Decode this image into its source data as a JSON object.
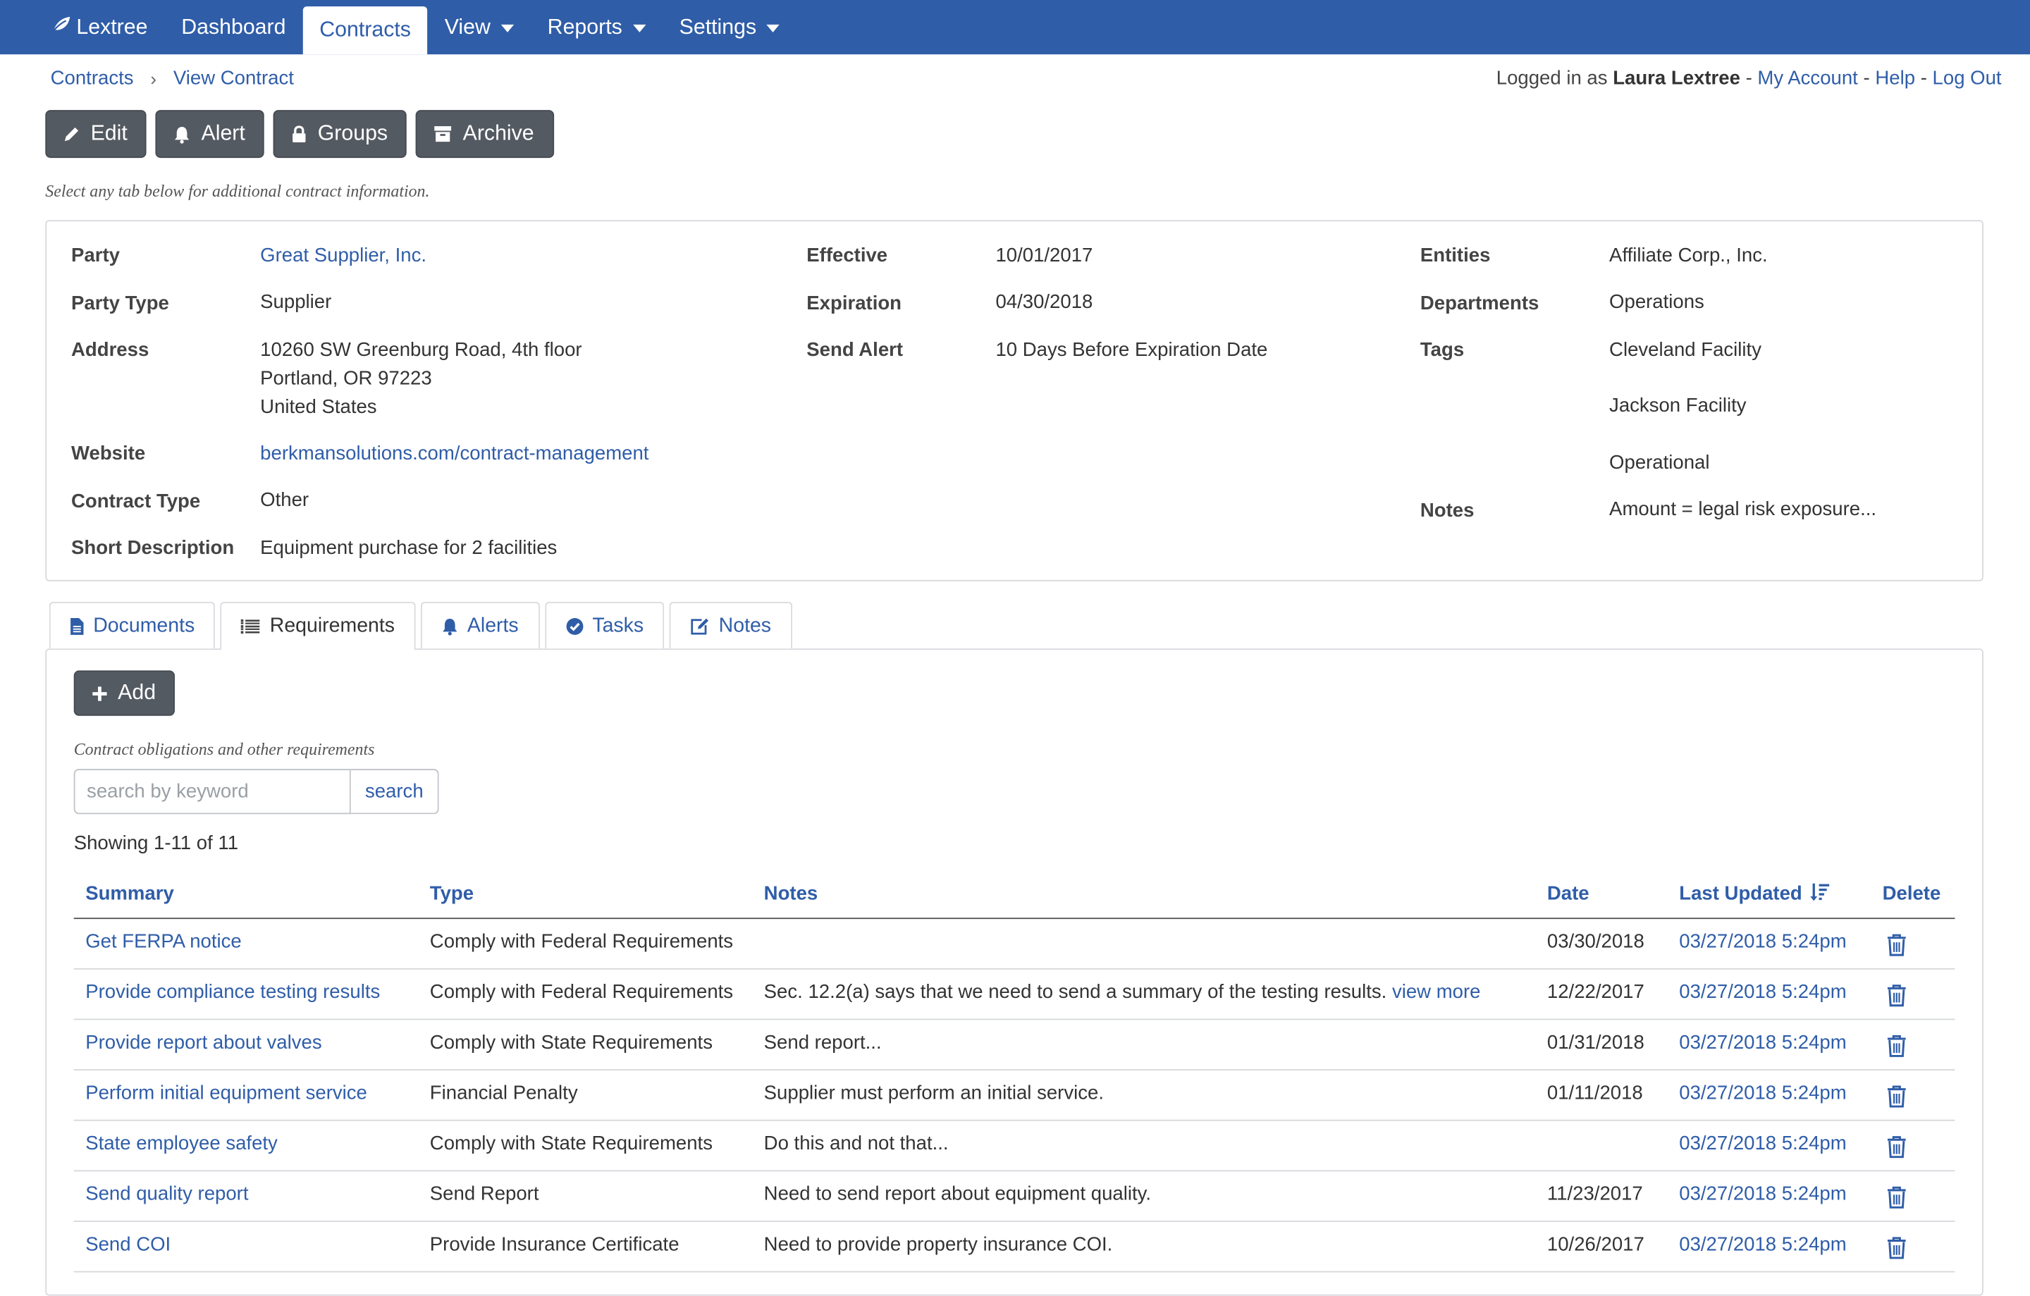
{
  "nav": {
    "brand": "Lextree",
    "items": [
      {
        "label": "Dashboard",
        "dropdown": false
      },
      {
        "label": "Contracts",
        "dropdown": false,
        "active": true
      },
      {
        "label": "View",
        "dropdown": true
      },
      {
        "label": "Reports",
        "dropdown": true
      },
      {
        "label": "Settings",
        "dropdown": true
      }
    ]
  },
  "breadcrumb": [
    "Contracts",
    "View Contract"
  ],
  "account": {
    "prefix": "Logged in as",
    "user": "Laura Lextree",
    "links": [
      "My Account",
      "Help",
      "Log Out"
    ],
    "sep": "-"
  },
  "actions": [
    {
      "label": "Edit",
      "icon": "pencil-icon"
    },
    {
      "label": "Alert",
      "icon": "bell-icon"
    },
    {
      "label": "Groups",
      "icon": "lock-icon"
    },
    {
      "label": "Archive",
      "icon": "archive-icon"
    }
  ],
  "hint": "Select any tab below for additional contract information.",
  "details": {
    "party_label": "Party",
    "party": "Great Supplier, Inc.",
    "party_type_label": "Party Type",
    "party_type": "Supplier",
    "address_label": "Address",
    "address_lines": [
      "10260 SW Greenburg Road, 4th floor",
      "Portland, OR 97223",
      "United States"
    ],
    "website_label": "Website",
    "website": "berkmansolutions.com/contract-management",
    "contract_type_label": "Contract Type",
    "contract_type": "Other",
    "short_desc_label": "Short Description",
    "short_desc": "Equipment purchase for 2 facilities",
    "effective_label": "Effective",
    "effective": "10/01/2017",
    "expiration_label": "Expiration",
    "expiration": "04/30/2018",
    "send_alert_label": "Send Alert",
    "send_alert": "10 Days Before Expiration Date",
    "entities_label": "Entities",
    "entities": "Affiliate Corp., Inc.",
    "departments_label": "Departments",
    "departments": "Operations",
    "tags_label": "Tags",
    "tags": [
      "Cleveland Facility",
      "Jackson Facility",
      "Operational"
    ],
    "notes_label": "Notes",
    "notes": "Amount = legal risk exposure..."
  },
  "tabs": [
    {
      "label": "Documents",
      "icon": "document-icon"
    },
    {
      "label": "Requirements",
      "icon": "list-icon",
      "active": true
    },
    {
      "label": "Alerts",
      "icon": "bell-icon"
    },
    {
      "label": "Tasks",
      "icon": "check-circle-icon"
    },
    {
      "label": "Notes",
      "icon": "edit-icon"
    }
  ],
  "requirements": {
    "add_label": "Add",
    "hint": "Contract obligations and other requirements",
    "search_placeholder": "search by keyword",
    "search_button": "search",
    "showing": "Showing 1-11 of 11",
    "columns": {
      "summary": "Summary",
      "type": "Type",
      "notes": "Notes",
      "date": "Date",
      "last_updated": "Last Updated",
      "delete": "Delete"
    },
    "rows": [
      {
        "summary": "Get FERPA notice",
        "type": "Comply with Federal Requirements",
        "notes": "",
        "more": "",
        "date": "03/30/2018",
        "updated": "03/27/2018 5:24pm"
      },
      {
        "summary": "Provide compliance testing results",
        "type": "Comply with Federal Requirements",
        "notes": "Sec. 12.2(a) says that we need to send a summary of the testing results.",
        "more": "view more",
        "date": "12/22/2017",
        "updated": "03/27/2018 5:24pm"
      },
      {
        "summary": "Provide report about valves",
        "type": "Comply with State Requirements",
        "notes": "Send report...",
        "more": "",
        "date": "01/31/2018",
        "updated": "03/27/2018 5:24pm"
      },
      {
        "summary": "Perform initial equipment service",
        "type": "Financial Penalty",
        "notes": "Supplier must perform an initial service.",
        "more": "",
        "date": "01/11/2018",
        "updated": "03/27/2018 5:24pm"
      },
      {
        "summary": "State employee safety",
        "type": "Comply with State Requirements",
        "notes": "Do this and not that...",
        "more": "",
        "date": "",
        "updated": "03/27/2018 5:24pm"
      },
      {
        "summary": "Send quality report",
        "type": "Send Report",
        "notes": "Need to send report about equipment quality.",
        "more": "",
        "date": "11/23/2017",
        "updated": "03/27/2018 5:24pm"
      },
      {
        "summary": "Send COI",
        "type": "Provide Insurance Certificate",
        "notes": "Need to provide property insurance COI.",
        "more": "",
        "date": "10/26/2017",
        "updated": "03/27/2018 5:24pm"
      }
    ]
  },
  "colors": {
    "primary": "#2f5da8",
    "button": "#545a62",
    "border": "#d8dadd"
  }
}
